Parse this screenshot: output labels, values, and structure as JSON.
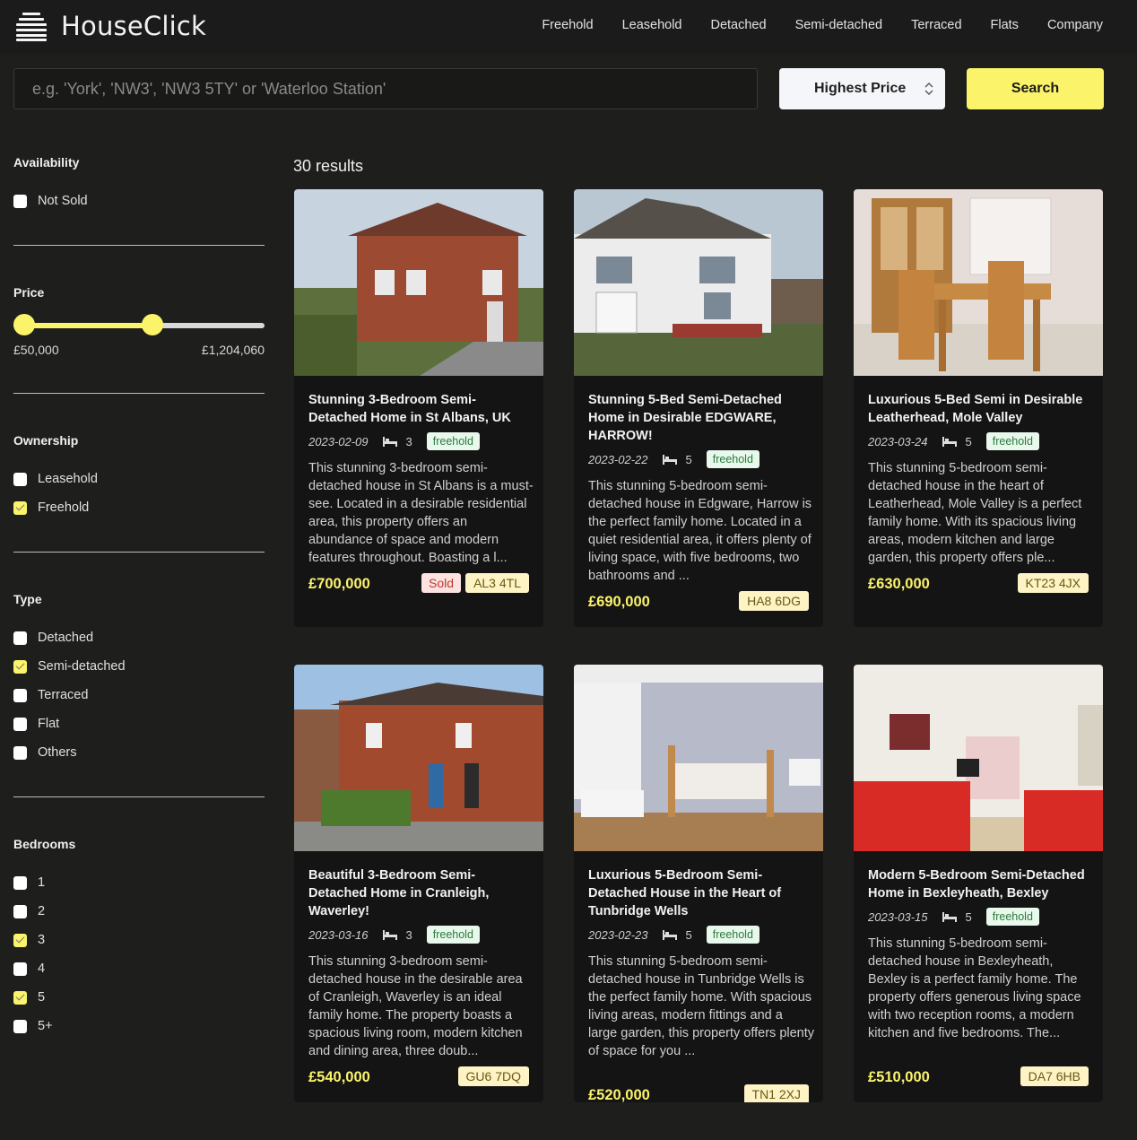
{
  "header": {
    "brand": "HouseClick",
    "nav": [
      "Freehold",
      "Leasehold",
      "Detached",
      "Semi-detached",
      "Terraced",
      "Flats",
      "Company"
    ]
  },
  "search": {
    "placeholder": "e.g. 'York', 'NW3', 'NW3 5TY' or 'Waterloo Station'",
    "sort_value": "Highest Price",
    "button_label": "Search"
  },
  "filters": {
    "availability": {
      "title": "Availability",
      "options": [
        {
          "label": "Not Sold",
          "checked": false
        }
      ]
    },
    "price": {
      "title": "Price",
      "min_label": "£50,000",
      "max_label": "£1,204,060",
      "low_fraction": 0.0,
      "high_fraction": 0.56
    },
    "ownership": {
      "title": "Ownership",
      "options": [
        {
          "label": "Leasehold",
          "checked": false
        },
        {
          "label": "Freehold",
          "checked": true
        }
      ]
    },
    "type": {
      "title": "Type",
      "options": [
        {
          "label": "Detached",
          "checked": false
        },
        {
          "label": "Semi-detached",
          "checked": true
        },
        {
          "label": "Terraced",
          "checked": false
        },
        {
          "label": "Flat",
          "checked": false
        },
        {
          "label": "Others",
          "checked": false
        }
      ]
    },
    "bedrooms": {
      "title": "Bedrooms",
      "options": [
        {
          "label": "1",
          "checked": false
        },
        {
          "label": "2",
          "checked": false
        },
        {
          "label": "3",
          "checked": true
        },
        {
          "label": "4",
          "checked": false
        },
        {
          "label": "5",
          "checked": true
        },
        {
          "label": "5+",
          "checked": false
        }
      ]
    }
  },
  "results": {
    "count_label": "30 results",
    "listings": [
      {
        "title": "Stunning 3-Bedroom Semi-Detached Home in St Albans, UK",
        "date": "2023-02-09",
        "bedrooms": "3",
        "ownership": "freehold",
        "description": "This stunning 3-bedroom semi-detached house in St Albans is a must-see. Located in a desirable residential area, this property offers an abundance of space and modern features throughout. Boasting a l...",
        "price": "£700,000",
        "sold_label": "Sold",
        "postcode": "AL3 4TL"
      },
      {
        "title": "Stunning 5-Bed Semi-Detached Home in Desirable EDGWARE, HARROW!",
        "date": "2023-02-22",
        "bedrooms": "5",
        "ownership": "freehold",
        "description": "This stunning 5-bedroom semi-detached house in Edgware, Harrow is the perfect family home. Located in a quiet residential area, it offers plenty of living space, with five bedrooms, two bathrooms and ...",
        "price": "£690,000",
        "postcode": "HA8 6DG"
      },
      {
        "title": "Luxurious 5-Bed Semi in Desirable Leatherhead, Mole Valley",
        "date": "2023-03-24",
        "bedrooms": "5",
        "ownership": "freehold",
        "description": "This stunning 5-bedroom semi-detached house in the heart of Leatherhead, Mole Valley is a perfect family home. With its spacious living areas, modern kitchen and large garden, this property offers ple...",
        "price": "£630,000",
        "postcode": "KT23 4JX"
      },
      {
        "title": "Beautiful 3-Bedroom Semi-Detached Home in Cranleigh, Waverley!",
        "date": "2023-03-16",
        "bedrooms": "3",
        "ownership": "freehold",
        "description": "This stunning 3-bedroom semi-detached house in the desirable area of Cranleigh, Waverley is an ideal family home. The property boasts a spacious living room, modern kitchen and dining area, three doub...",
        "price": "£540,000",
        "postcode": "GU6 7DQ"
      },
      {
        "title": "Luxurious 5-Bedroom Semi-Detached House in the Heart of Tunbridge Wells",
        "date": "2023-02-23",
        "bedrooms": "5",
        "ownership": "freehold",
        "description": "This stunning 5-bedroom semi-detached house in Tunbridge Wells is the perfect family home. With spacious living areas, modern fittings and a large garden, this property offers plenty of space for you ...",
        "price": "£520,000",
        "postcode": "TN1 2XJ"
      },
      {
        "title": "Modern 5-Bedroom Semi-Detached Home in Bexleyheath, Bexley",
        "date": "2023-03-15",
        "bedrooms": "5",
        "ownership": "freehold",
        "description": "This stunning 5-bedroom semi-detached house in Bexleyheath, Bexley is a perfect family home. The property offers generous living space with two reception rooms, a modern kitchen and five bedrooms. The...",
        "price": "£510,000",
        "postcode": "DA7 6HB"
      }
    ]
  },
  "colors": {
    "accent": "#fbf36a",
    "background": "#1e1e1c",
    "card": "#141414"
  }
}
